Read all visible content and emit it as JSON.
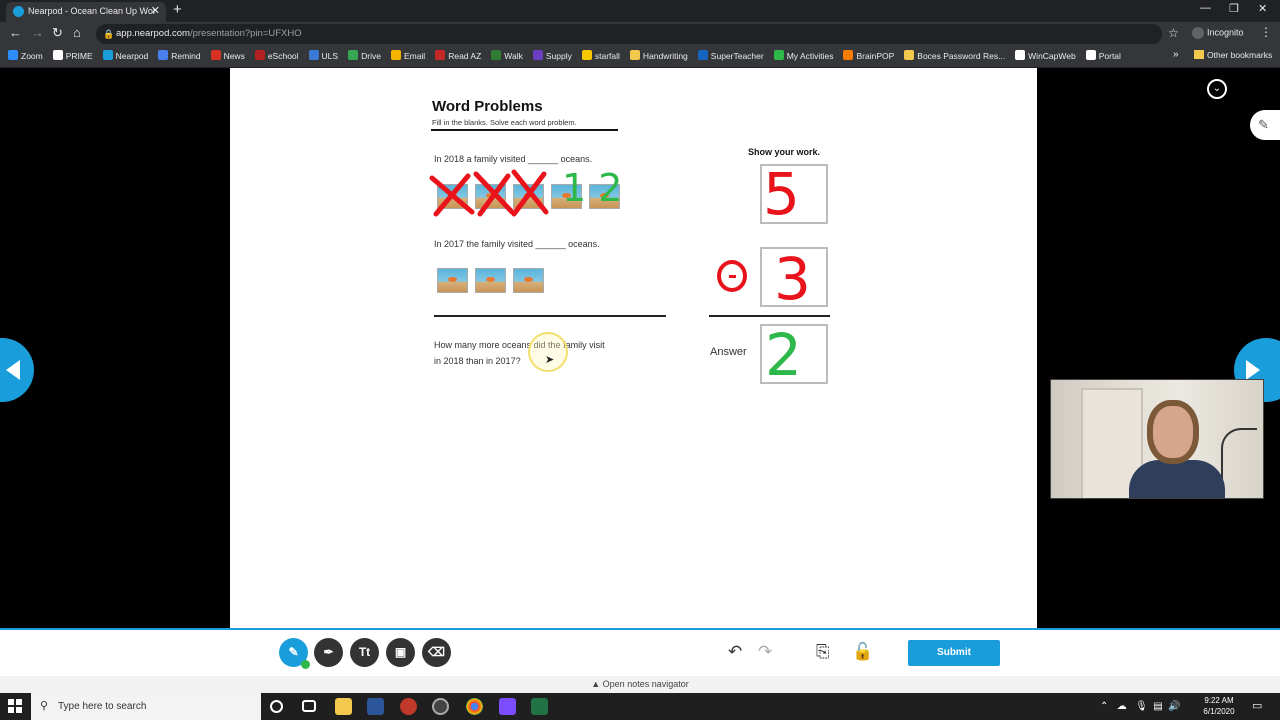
{
  "browser": {
    "tab_title": "Nearpod - Ocean Clean Up Wor",
    "url_host": "app.nearpod.com",
    "url_path": "/presentation?pin=UFXHO",
    "profile": "Incognito",
    "other_bookmarks": "Other bookmarks",
    "bookmarks": [
      {
        "label": "Zoom",
        "color": "#2d8cff"
      },
      {
        "label": "PRIME",
        "color": "#ffffff"
      },
      {
        "label": "Nearpod",
        "color": "#1a9ddb"
      },
      {
        "label": "Remind",
        "color": "#4a7ff0"
      },
      {
        "label": "News",
        "color": "#d93025"
      },
      {
        "label": "eSchool",
        "color": "#b22222"
      },
      {
        "label": "ULS",
        "color": "#3a7ad5"
      },
      {
        "label": "Drive",
        "color": "#34a853"
      },
      {
        "label": "Email",
        "color": "#f4b400"
      },
      {
        "label": "Read AZ",
        "color": "#c62828"
      },
      {
        "label": "Walk",
        "color": "#2e7d32"
      },
      {
        "label": "Supply",
        "color": "#6a3fc1"
      },
      {
        "label": "starfall",
        "color": "#f9c700"
      },
      {
        "label": "Handwriting",
        "color": "#f2c94c"
      },
      {
        "label": "SuperTeacher",
        "color": "#1565c0"
      },
      {
        "label": "My Activities",
        "color": "#2fb84a"
      },
      {
        "label": "BrainPOP",
        "color": "#f57c00"
      },
      {
        "label": "Boces Password Res...",
        "color": "#f2c94c"
      },
      {
        "label": "WinCapWeb",
        "color": "#ffffff"
      },
      {
        "label": "Portal",
        "color": "#ffffff"
      }
    ]
  },
  "worksheet": {
    "title": "Word Problems",
    "subtitle": "Fill in the blanks.  Solve each word problem.",
    "q1": "In 2018 a family visited ______ oceans.",
    "q2": "In 2017 the family visited ______ oceans.",
    "q3_line1": "How many more oceans did the family visit",
    "q3_line2": "in 2018 than in 2017?",
    "show_work": "Show your work.",
    "answer_label": "Answer",
    "ink_count_marks": "1 2"
  },
  "handwriting": {
    "box1_value": "5",
    "box2_value": "3",
    "answer_value": "2",
    "red": "#e8131b",
    "green": "#2fb84a"
  },
  "toolbar": {
    "submit_label": "Submit",
    "text_tool_label": "Tt",
    "notes_navigator": "Open notes navigator",
    "accent": "#1a9ddb"
  },
  "taskbar": {
    "search_placeholder": "Type here to search",
    "time": "9:22 AM",
    "date": "6/1/2020"
  }
}
